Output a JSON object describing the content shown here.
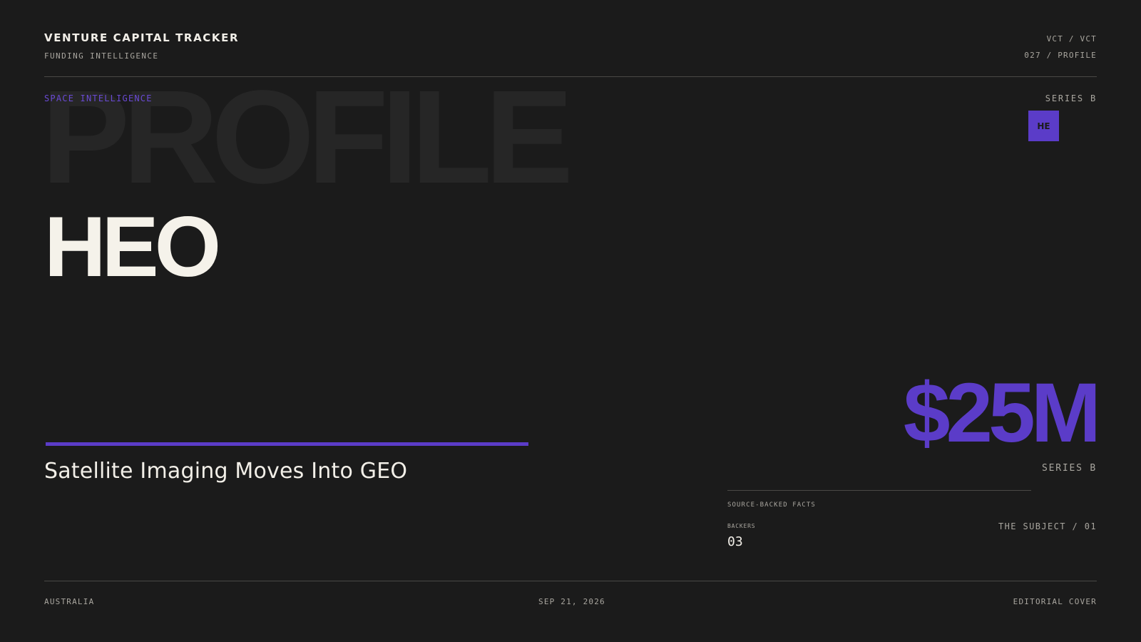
{
  "header": {
    "title": "VENTURE CAPITAL TRACKER",
    "subtitle": "FUNDING INTELLIGENCE",
    "code": "VCT / VCT",
    "issue": "027 / PROFILE"
  },
  "profile": {
    "sector": "SPACE INTELLIGENCE",
    "stage": "SERIES B",
    "ghost_word": "PROFILE",
    "avatar_initials": "HE",
    "company": "HEO",
    "headline": "Satellite Imaging Moves Into GEO"
  },
  "funding": {
    "amount": "$25M",
    "stage": "SERIES B",
    "facts_label": "SOURCE-BACKED FACTS",
    "backers_label": "BACKERS",
    "backers_value": "03",
    "subject": "THE SUBJECT / 01"
  },
  "footer": {
    "location": "AUSTRALIA",
    "date": "SEP 21, 2026",
    "type": "EDITORIAL COVER"
  },
  "colors": {
    "background": "#1b1b1b",
    "accent": "#5b3cc8",
    "text": "#f2efe8",
    "muted": "#a9a69f"
  }
}
